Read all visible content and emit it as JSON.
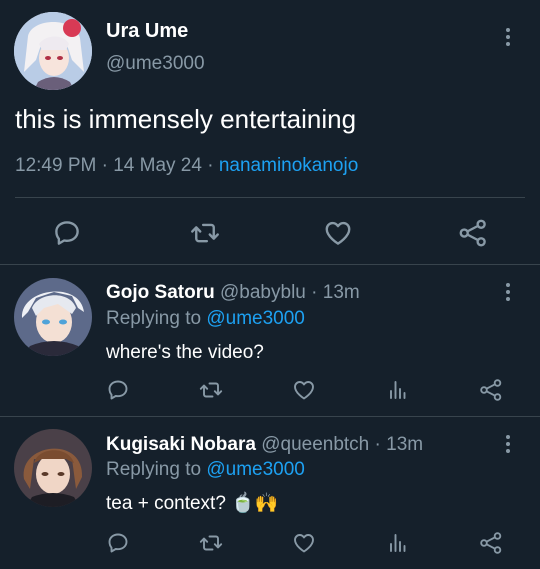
{
  "main_tweet": {
    "display_name": "Ura Ume",
    "handle": "@ume3000",
    "text": "this is immensely entertaining",
    "time": "12:49 PM",
    "date": "14 May 24",
    "separator": "·",
    "via": "nanaminokanojo"
  },
  "replies": [
    {
      "display_name": "Gojo Satoru",
      "handle": "@babyblu",
      "separator": "·",
      "age": "13m",
      "replying_prefix": "Replying to",
      "replying_to": "@ume3000",
      "text": "where's the video?"
    },
    {
      "display_name": "Kugisaki Nobara",
      "handle": "@queenbtch",
      "separator": "·",
      "age": "13m",
      "replying_prefix": "Replying to",
      "replying_to": "@ume3000",
      "text": "tea + context?",
      "emoji": "🍵🙌"
    }
  ],
  "icons": [
    "reply-icon",
    "retweet-icon",
    "like-icon",
    "share-icon",
    "analytics-icon",
    "more-icon"
  ],
  "colors": {
    "background": "#15202b",
    "accent": "#1da1f2",
    "muted": "#8899a6",
    "divider": "#38444d",
    "text": "#ffffff"
  }
}
